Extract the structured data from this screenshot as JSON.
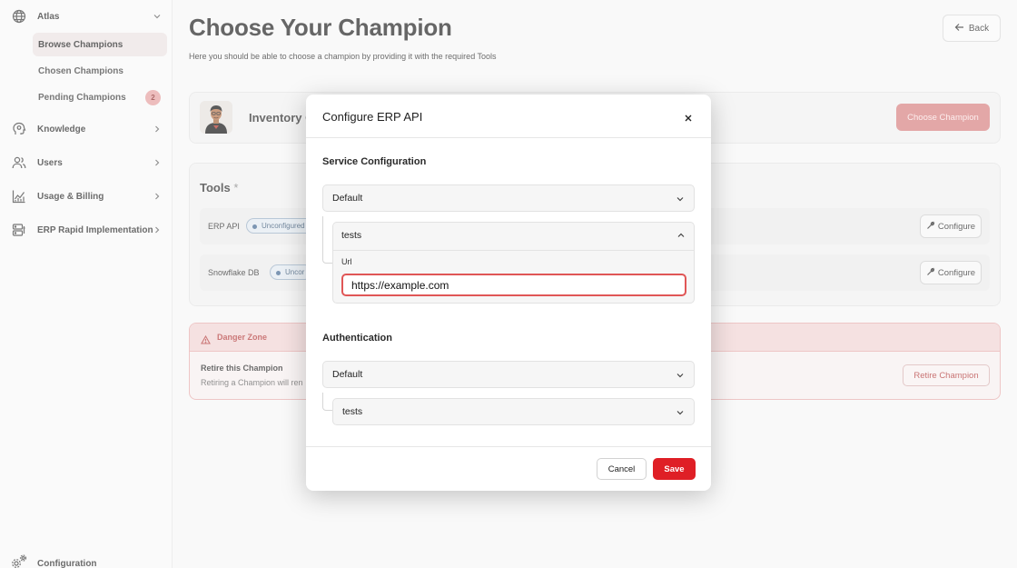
{
  "sidebar": {
    "groups": [
      {
        "label": "Atlas",
        "icon": "globe-icon"
      },
      {
        "label": "Knowledge",
        "icon": "head-brain-icon"
      },
      {
        "label": "Users",
        "icon": "users-icon"
      },
      {
        "label": "Usage & Billing",
        "icon": "chart-trend-icon"
      },
      {
        "label": "ERP Rapid Implementation",
        "icon": "server-icon"
      }
    ],
    "atlas_items": [
      {
        "label": "Browse Champions",
        "active": true
      },
      {
        "label": "Chosen Champions",
        "active": false
      },
      {
        "label": "Pending Champions",
        "active": false,
        "badge": "2"
      }
    ],
    "footer": {
      "label": "Configuration",
      "icon": "gears-icon"
    }
  },
  "main": {
    "title": "Choose Your Champion",
    "subtitle": "Here you should be able to choose a champion by providing it with the required Tools",
    "back_label": "Back",
    "champion": {
      "name": "Inventory C",
      "choose_label": "Choose Champion"
    },
    "tools": {
      "title": "Tools",
      "required_mark": "*",
      "rows": [
        {
          "name": "ERP API",
          "status": "Unconfigured",
          "configure_label": "Configure"
        },
        {
          "name": "Snowflake DB",
          "status": "Uncor",
          "configure_label": "Configure"
        }
      ]
    },
    "danger": {
      "title": "Danger Zone",
      "retire_title": "Retire this Champion",
      "retire_desc": "Retiring a Champion will ren",
      "retire_label": "Retire Champion"
    }
  },
  "modal": {
    "title": "Configure ERP API",
    "service": {
      "title": "Service Configuration",
      "select_value": "Default",
      "env_value": "tests",
      "url_label": "Url",
      "url_value": "https://example.com"
    },
    "auth": {
      "title": "Authentication",
      "select_value": "Default",
      "env_value": "tests"
    },
    "cancel_label": "Cancel",
    "save_label": "Save"
  },
  "colors": {
    "primary_red": "#df1f26",
    "choose_button": "#d98585",
    "danger_text": "#b84545",
    "status_badge": "#e3eaf1"
  }
}
